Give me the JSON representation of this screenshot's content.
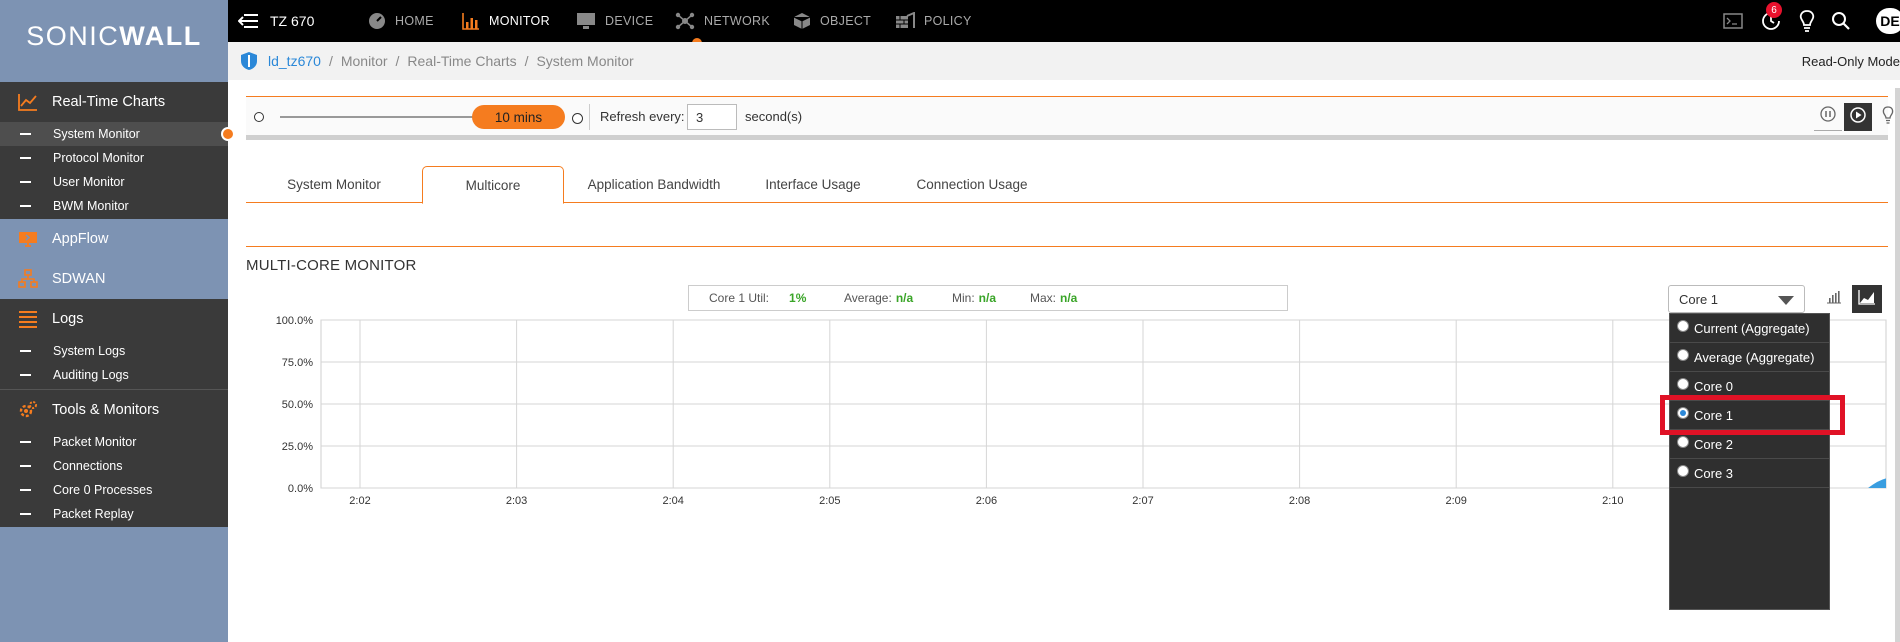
{
  "app": {
    "logo_text_light": "SONIC",
    "logo_text_bold": "WALL"
  },
  "sidebar": {
    "groups": [
      {
        "label": "Real-Time Charts",
        "items": [
          "System Monitor",
          "Protocol Monitor",
          "User Monitor",
          "BWM Monitor"
        ],
        "active_item": "System Monitor"
      },
      {
        "label": "AppFlow",
        "items": []
      },
      {
        "label": "SDWAN",
        "items": []
      },
      {
        "label": "Logs",
        "items": [
          "System Logs",
          "Auditing Logs"
        ]
      },
      {
        "label": "Tools & Monitors",
        "items": [
          "Packet Monitor",
          "Connections",
          "Core 0 Processes",
          "Packet Replay"
        ]
      }
    ]
  },
  "topbar": {
    "device": "TZ 670",
    "nav": [
      "HOME",
      "MONITOR",
      "DEVICE",
      "NETWORK",
      "OBJECT",
      "POLICY"
    ],
    "active_nav": "MONITOR",
    "notification_count": "6",
    "user_initials": "DE"
  },
  "breadcrumb": {
    "items": [
      "ld_tz670",
      "Monitor",
      "Real-Time Charts",
      "System Monitor"
    ],
    "separator": "/",
    "mode": "Read-Only Mode"
  },
  "controls": {
    "time_range": "10 mins",
    "refresh_label": "Refresh every:",
    "refresh_value": "3",
    "refresh_unit": "second(s)"
  },
  "tabs": [
    "System Monitor",
    "Multicore",
    "Application Bandwidth",
    "Interface Usage",
    "Connection Usage"
  ],
  "active_tab": "Multicore",
  "section": {
    "title": "MULTI-CORE MONITOR"
  },
  "stats": {
    "util_label": "Core 1 Util:",
    "util_value": "1%",
    "avg_label": "Average:",
    "avg_value": "n/a",
    "min_label": "Min:",
    "min_value": "n/a",
    "max_label": "Max:",
    "max_value": "n/a"
  },
  "core_select": {
    "selected": "Core 1",
    "options": [
      "Current (Aggregate)",
      "Average (Aggregate)",
      "Core 0",
      "Core 1",
      "Core 2",
      "Core 3"
    ],
    "checked_index": 3
  },
  "colors": {
    "accent": "#f57c1f",
    "highlight": "#e01226",
    "value_green": "#3aa528",
    "link_blue": "#2b88d8",
    "series": "#3a9ee0"
  },
  "chart_data": {
    "type": "area",
    "y_ticks": [
      "100.0%",
      "75.0%",
      "50.0%",
      "25.0%",
      "0.0%"
    ],
    "x_ticks": [
      "2:02",
      "2:03",
      "2:04",
      "2:05",
      "2:06",
      "2:07",
      "2:08",
      "2:09",
      "2:10"
    ],
    "ylim": [
      0,
      100
    ],
    "grid": true,
    "series": [
      {
        "x": [
          "2:11"
        ],
        "values": [
          1
        ]
      }
    ]
  }
}
